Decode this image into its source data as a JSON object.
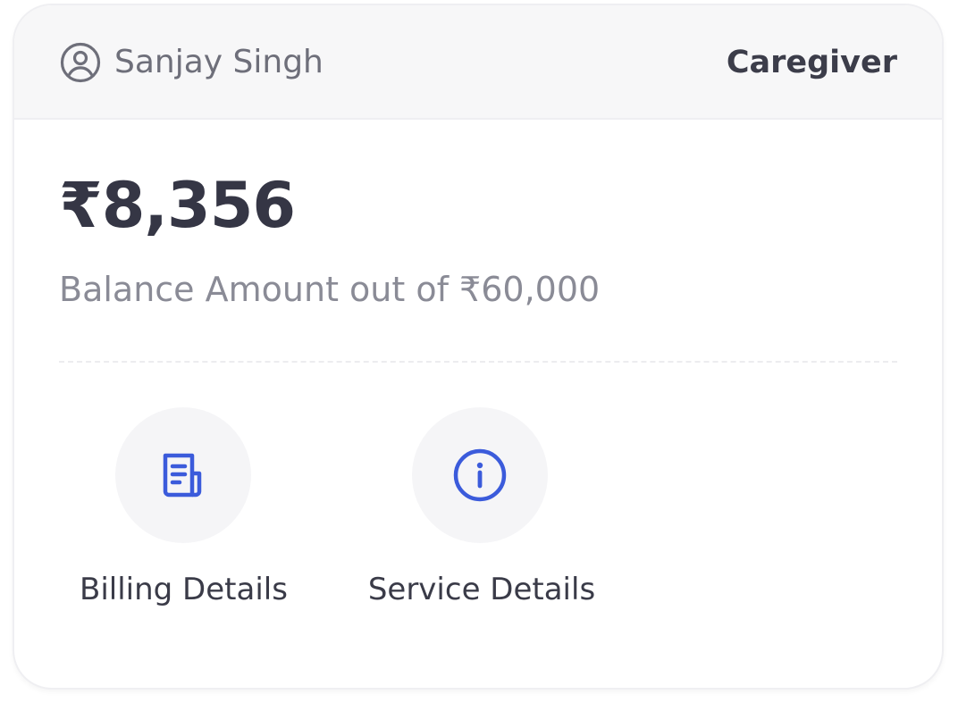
{
  "header": {
    "user_name": "Sanjay Singh",
    "role": "Caregiver",
    "user_icon": "user-circle-icon"
  },
  "balance": {
    "amount": "₹8,356",
    "subtitle": "Balance Amount out of ₹60,000"
  },
  "actions": [
    {
      "label": "Billing Details",
      "icon": "receipt-icon"
    },
    {
      "label": "Service Details",
      "icon": "info-icon"
    }
  ],
  "colors": {
    "accent": "#3b5bdb",
    "header_bg": "#f7f7f8",
    "text_dark": "#353645",
    "text_muted": "#8a8b96"
  }
}
